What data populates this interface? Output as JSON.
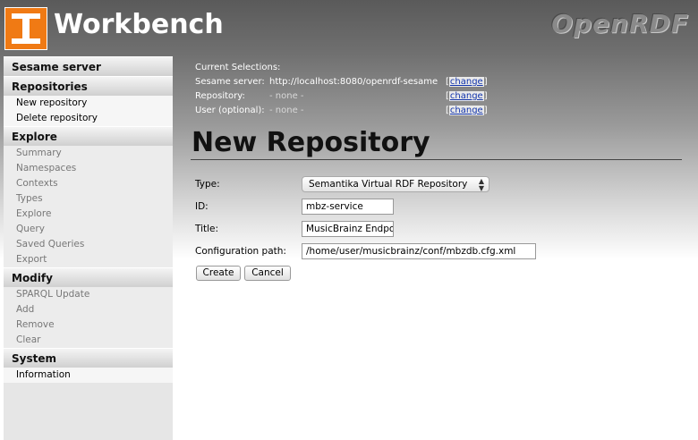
{
  "header": {
    "app_title": "Workbench",
    "brand": "OpenRDF"
  },
  "sidebar": {
    "groups": [
      {
        "label": "Sesame server",
        "items": []
      },
      {
        "label": "Repositories",
        "items": [
          "New repository",
          "Delete repository"
        ]
      },
      {
        "label": "Explore",
        "items": [
          "Summary",
          "Namespaces",
          "Contexts",
          "Types",
          "Explore",
          "Query",
          "Saved Queries",
          "Export"
        ]
      },
      {
        "label": "Modify",
        "items": [
          "SPARQL Update",
          "Add",
          "Remove",
          "Clear"
        ]
      },
      {
        "label": "System",
        "items": [
          "Information"
        ]
      }
    ],
    "active_items": [
      "New repository",
      "Delete repository",
      "Information"
    ]
  },
  "selections": {
    "heading": "Current Selections:",
    "server_label": "Sesame server:",
    "server_value": "http://localhost:8080/openrdf-sesame",
    "repository_label": "Repository:",
    "repository_value": "- none -",
    "user_label": "User (optional):",
    "user_value": "- none -",
    "change_label": "change",
    "open_bracket": "[",
    "close_bracket": "]"
  },
  "page": {
    "title": "New Repository"
  },
  "form": {
    "type_label": "Type:",
    "type_value": "Semantika Virtual RDF Repository",
    "id_label": "ID:",
    "id_value": "mbz-service",
    "title_label": "Title:",
    "title_value": "MusicBrainz Endpoint",
    "config_label": "Configuration path:",
    "config_value": "/home/user/musicbrainz/conf/mbzdb.cfg.xml",
    "create_label": "Create",
    "cancel_label": "Cancel"
  }
}
